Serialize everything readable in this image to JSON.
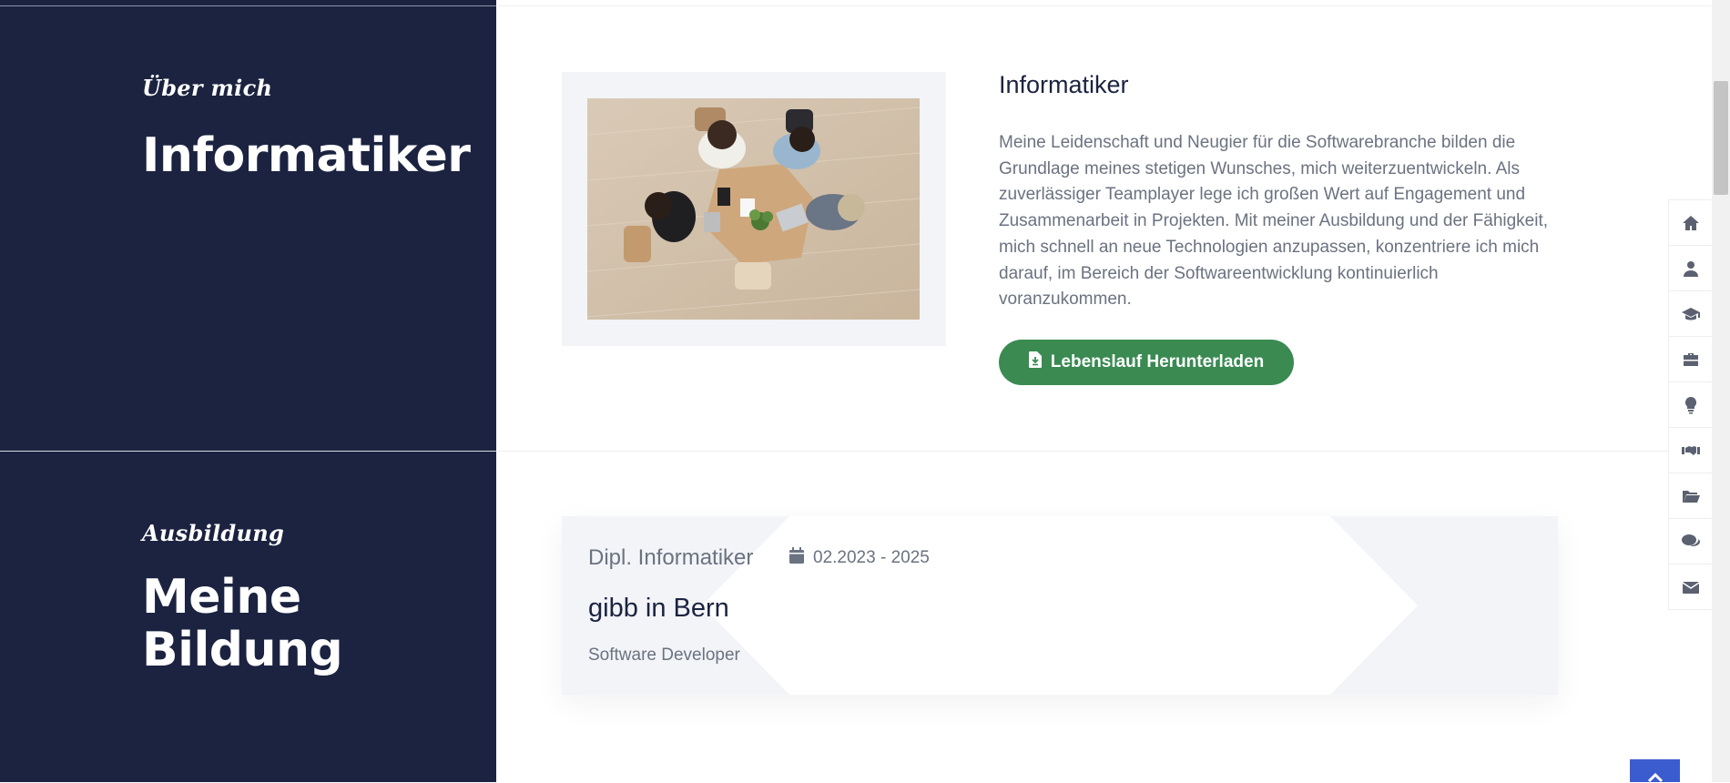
{
  "about": {
    "subtitle": "Über mich",
    "title": "Informatiker",
    "heading": "Informatiker",
    "text": "Meine Leidenschaft und Neugier für die Softwarebranche bilden die Grundlage meines stetigen Wunsches, mich weiterzuentwickeln. Als zuverlässiger Teamplayer lege ich großen Wert auf Engagement und Zusammenarbeit in Projekten. Mit meiner Ausbildung und der Fähigkeit, mich schnell an neue Technologien anzupassen, konzentriere ich mich darauf, im Bereich der Softwareentwicklung kontinuierlich voranzukommen.",
    "button_label": "Lebenslauf Herunterladen",
    "button_icon": "file-download-icon"
  },
  "education": {
    "subtitle": "Ausbildung",
    "title_line1": "Meine",
    "title_line2": "Bildung",
    "items": [
      {
        "degree": "Dipl. Informatiker",
        "date": "02.2023 - 2025",
        "school": "gibb in Bern",
        "role": "Software Developer"
      }
    ]
  },
  "side_nav": {
    "icons": [
      "home-icon",
      "user-icon",
      "graduation-cap-icon",
      "briefcase-icon",
      "lightbulb-icon",
      "handshake-icon",
      "folder-open-icon",
      "comments-icon",
      "envelope-icon"
    ]
  },
  "colors": {
    "panel_bg": "#1b2340",
    "accent_green": "#3a8a52",
    "accent_blue": "#3b5ccf"
  }
}
